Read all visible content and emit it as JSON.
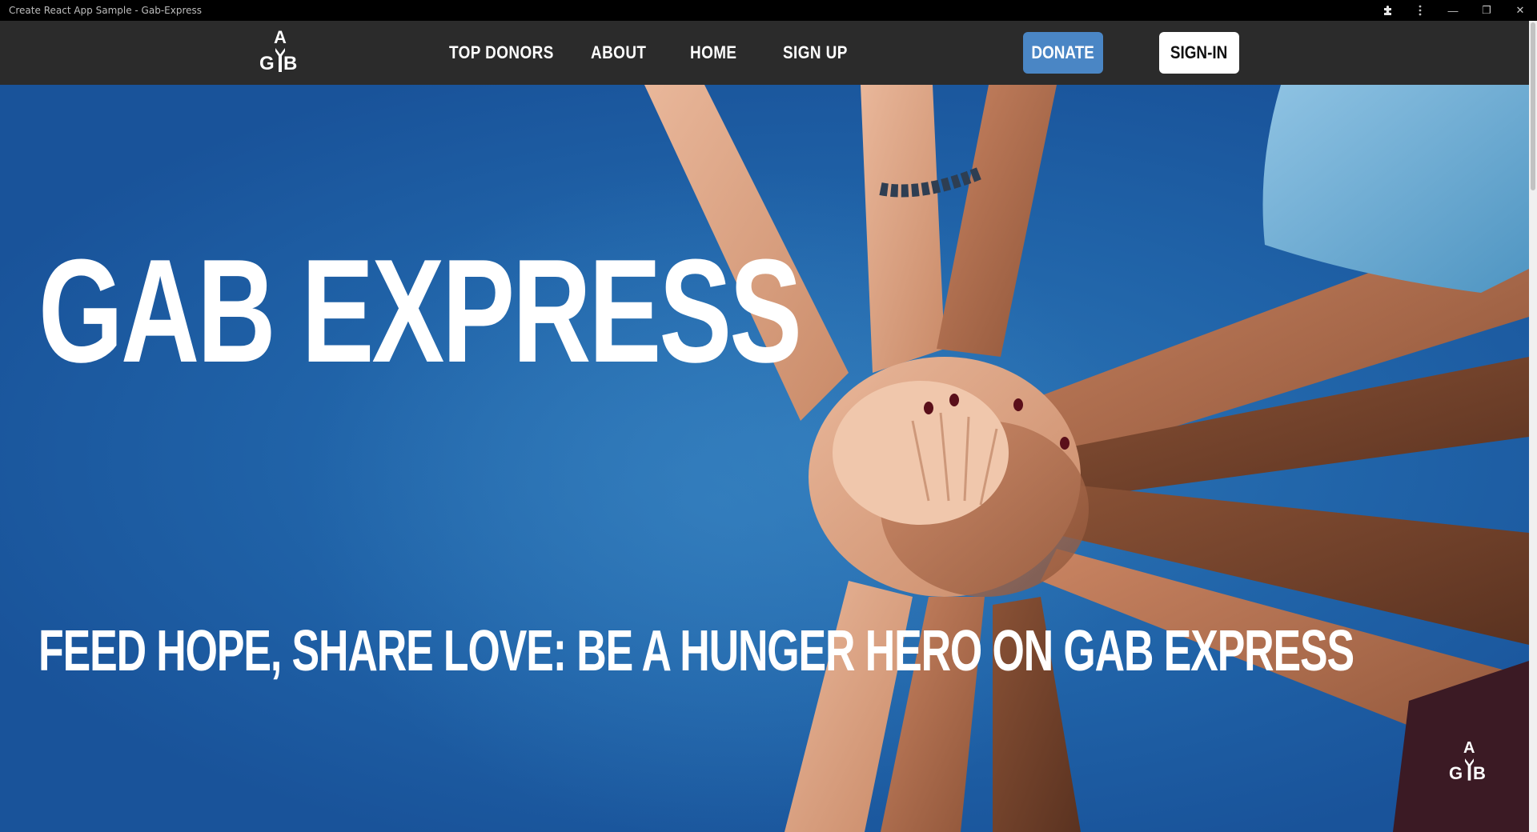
{
  "window": {
    "title": "Create React App Sample - Gab-Express",
    "controls": {
      "extensions_icon": "puzzle-icon",
      "menu_icon": "kebab-icon",
      "minimize": "—",
      "restore": "❐",
      "close": "✕"
    }
  },
  "navbar": {
    "logo": {
      "a": "A",
      "g": "G",
      "b": "B"
    },
    "links": [
      "TOP DONORS",
      "ABOUT",
      "HOME",
      "SIGN UP"
    ],
    "donate_label": "DONATE",
    "signin_label": "SIGN-IN"
  },
  "hero": {
    "title": "GAB EXPRESS",
    "tagline": "FEED HOPE, SHARE LOVE: BE A HUNGER HERO ON GAB EXPRESS",
    "corner_logo": {
      "a": "A",
      "g": "G",
      "b": "B"
    }
  },
  "colors": {
    "navbar_bg": "#2b2b2b",
    "donate_bg": "#4a86c5",
    "signin_bg": "#ffffff",
    "hero_bg": "#1e5aa0"
  }
}
